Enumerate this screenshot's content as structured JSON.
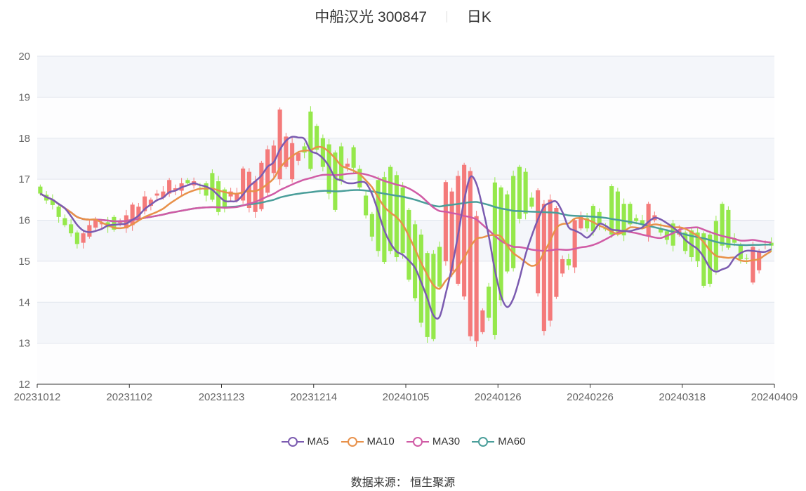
{
  "header": {
    "title": "中船汉光 300847",
    "period": "日K"
  },
  "footer": {
    "source": "数据来源： 恒生聚源"
  },
  "colors": {
    "up": "#f47a7a",
    "down": "#95e84b",
    "MA5": "#7b5bb0",
    "MA10": "#e8914a",
    "MA30": "#d05ba5",
    "MA60": "#4a9e9a",
    "band": "#f4f6fa",
    "grid": "#e2e6ee"
  },
  "chart_data": {
    "type": "candlestick",
    "y_ticks": [
      "12",
      "13",
      "14",
      "15",
      "16",
      "17",
      "18",
      "19",
      "20"
    ],
    "ylim": [
      12,
      20
    ],
    "x_ticks": [
      "20231012",
      "20231102",
      "20231123",
      "20231214",
      "20240105",
      "20240126",
      "20240226",
      "20240318",
      "20240409"
    ],
    "legend": [
      "MA5",
      "MA10",
      "MA30",
      "MA60"
    ],
    "ohlc_open": [
      16.82,
      16.62,
      16.5,
      16.33,
      16.05,
      15.9,
      15.7,
      15.45,
      15.6,
      15.82,
      15.9,
      15.95,
      16.08,
      15.93,
      15.8,
      15.88,
      16.05,
      16.22,
      16.35,
      16.6,
      16.55,
      16.65,
      16.72,
      16.72,
      16.98,
      16.85,
      16.78,
      16.9,
      17.15,
      16.95,
      16.75,
      16.58,
      16.48,
      16.48,
      16.3,
      16.2,
      16.27,
      16.67,
      17.15,
      17.0,
      17.3,
      17.0,
      17.45,
      17.8,
      18.65,
      18.3,
      18.0,
      17.85,
      17.65,
      17.8,
      17.3,
      17.78,
      17.25,
      16.6,
      16.15,
      16.98,
      17.05,
      17.3,
      17.1,
      16.8,
      16.25,
      15.9,
      15.65,
      15.2,
      15.18,
      15.35,
      15.0,
      14.75,
      14.45,
      14.14,
      13.17,
      13.05,
      13.27,
      14.38,
      16.92,
      16.8,
      16.63,
      17.08,
      17.3,
      17.18,
      16.55,
      14.22,
      13.3,
      13.55,
      14.13,
      14.7,
      15.05,
      14.85,
      15.8,
      16.05,
      16.35,
      16.2,
      15.8,
      16.83,
      16.7,
      16.4,
      16.4,
      16.05,
      16.0,
      15.62,
      16.0,
      15.8,
      15.73,
      15.92,
      15.65,
      15.7,
      15.75,
      15.7,
      15.68,
      15.65,
      15.98,
      16.4,
      16.25,
      15.55,
      15.4,
      15.08,
      14.48,
      14.78,
      15.4,
      15.45,
      15.2,
      15.05
    ],
    "ohlc_close": [
      16.65,
      16.48,
      16.37,
      16.08,
      15.88,
      15.68,
      15.42,
      15.68,
      15.88,
      16.03,
      15.93,
      15.83,
      15.77,
      15.95,
      16.12,
      16.38,
      16.33,
      16.58,
      16.5,
      16.65,
      16.7,
      16.98,
      16.78,
      16.9,
      16.9,
      16.95,
      16.75,
      16.6,
      16.5,
      16.2,
      16.3,
      16.7,
      16.66,
      17.26,
      17.18,
      16.95,
      17.4,
      17.73,
      17.82,
      18.7,
      18.04,
      17.88,
      17.64,
      17.65,
      17.25,
      17.72,
      17.3,
      16.65,
      16.25,
      16.95,
      17.38,
      17.28,
      16.8,
      16.12,
      15.6,
      15.25,
      14.98,
      15.25,
      15.1,
      15.2,
      14.55,
      14.1,
      13.5,
      13.15,
      13.1,
      14.38,
      16.93,
      16.7,
      17.08,
      17.35,
      17.2,
      16.1,
      13.8,
      13.62,
      13.2,
      14.05,
      14.75,
      14.83,
      16.03,
      16.16,
      16.33,
      16.73,
      16.4,
      16.5,
      16.3,
      15.05,
      14.9,
      16.0,
      16.12,
      15.8,
      15.73,
      15.9,
      15.78,
      15.65,
      15.72,
      15.63,
      15.9,
      15.98,
      15.9,
      16.4,
      16.12,
      15.7,
      15.52,
      15.38,
      15.75,
      15.25,
      15.1,
      15.0,
      14.4,
      14.45,
      14.78,
      15.38,
      15.33,
      15.45,
      15.05,
      15.07,
      15.35,
      15.25,
      15.42,
      15.38
    ]
  }
}
